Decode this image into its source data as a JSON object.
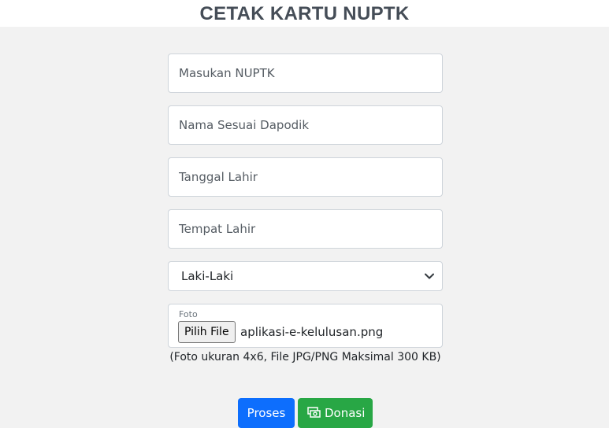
{
  "header": {
    "title": "CETAK KARTU NUPTK"
  },
  "form": {
    "nuptk": {
      "placeholder": "Masukan NUPTK",
      "value": ""
    },
    "nama": {
      "placeholder": "Nama Sesuai Dapodik",
      "value": ""
    },
    "tanggal_lahir": {
      "placeholder": "Tanggal Lahir",
      "value": ""
    },
    "tempat_lahir": {
      "placeholder": "Tempat Lahir",
      "value": ""
    },
    "jenis_kelamin": {
      "selected": "Laki-Laki"
    },
    "foto": {
      "label": "Foto",
      "button_label": "Pilih File",
      "file_name": "aplikasi-e-kelulusan.png"
    },
    "hint": "(Foto ukuran 4x6, File JPG/PNG Maksimal 300 KB)"
  },
  "actions": {
    "proses_label": "Proses",
    "donasi_label": "Donasi",
    "donasi_icon": "money-icon"
  },
  "colors": {
    "primary": "#0d6efd",
    "success": "#28a745",
    "header_text": "#454d57",
    "background": "#f2f2f2"
  }
}
